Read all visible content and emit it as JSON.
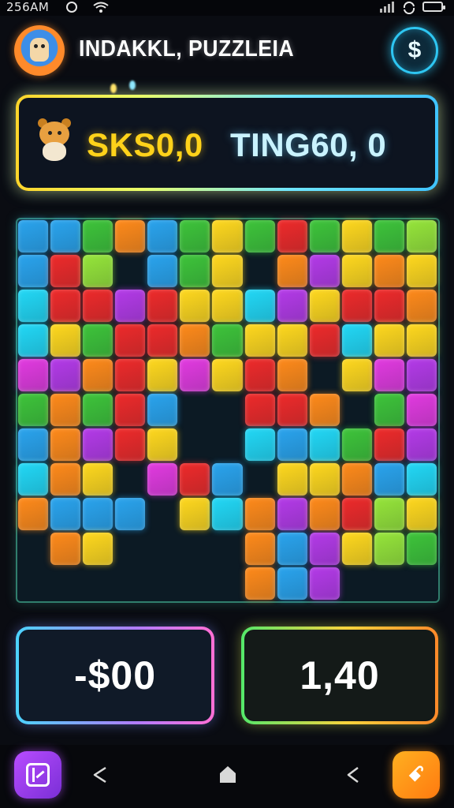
{
  "status_bar": {
    "time": "256AM",
    "icons": [
      "google-icon",
      "wifi-icon",
      "signal-icon",
      "rotation-icon",
      "battery-icon"
    ]
  },
  "header": {
    "avatar_icon": "mascot-avatar-icon",
    "title": "INDAKKL, PUZZLEIA",
    "coin_button_icon": "dollar-coin-icon",
    "coin_button_label": "$"
  },
  "score_banner": {
    "mascot_icon": "bear-mascot-icon",
    "primary_score": "SKS0,0",
    "secondary_score": "TING60, 0",
    "primary_color": "#ffd21a",
    "secondary_color": "#c9f3ff"
  },
  "puzzle_grid": {
    "columns": 13,
    "rows": 11,
    "palette": {
      "B": "#2aa4ee",
      "C": "#22d8f6",
      "G": "#3ec43a",
      "L": "#96e53a",
      "Y": "#ffd81e",
      "O": "#ff8a1a",
      "R": "#ee2a2a",
      "P": "#b43ae8",
      "M": "#e23ae0",
      "_": "#0c1a24"
    },
    "rows_data": [
      "BBGOBGYGRGYGL",
      "BRL_BGY_OPYOY",
      "CRRPRYYCPYRRO",
      "CYGRROGYYRCYY",
      "MPORYMYRO_YMP",
      "GOGRB__RRO_GM",
      "BOPRY__CBCGRP",
      "COY_MRB_YYOBC",
      "OBBB_YCOPORLY",
      "_OY____OBPYLG",
      "_______OBP___"
    ]
  },
  "stats": {
    "left_value": "-$00",
    "right_value": "1,40"
  },
  "nav_bar": {
    "left_button_icon": "puzzle-app-icon",
    "back_icon": "back-icon",
    "home_icon": "home-icon",
    "recent_icon": "recent-apps-icon",
    "right_button_icon": "game-controller-icon",
    "right_button_label": "ꗃ"
  }
}
